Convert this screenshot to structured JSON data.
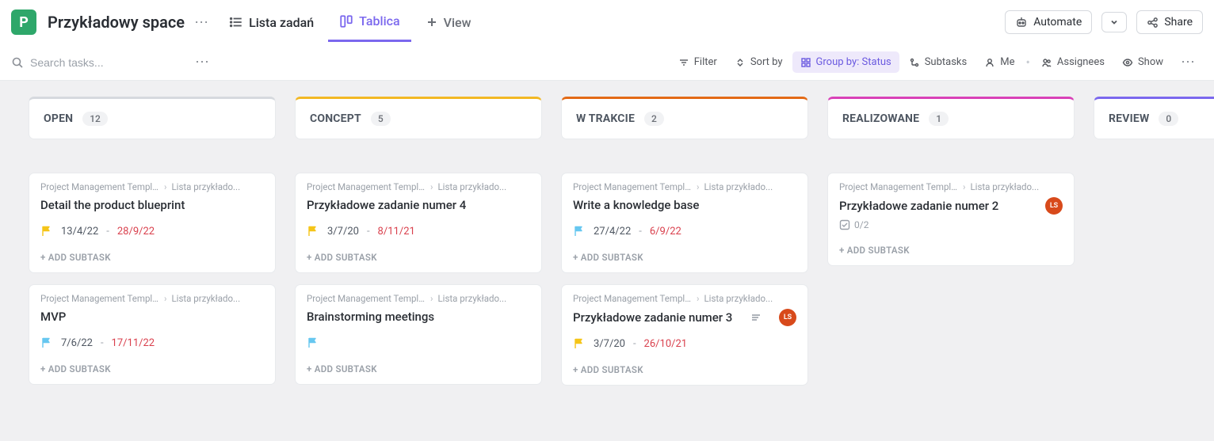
{
  "header": {
    "space_initial": "P",
    "space_title": "Przykładowy space",
    "tabs": {
      "list": "Lista zadań",
      "board": "Tablica",
      "add": "View"
    },
    "automate": "Automate",
    "share": "Share"
  },
  "toolbar": {
    "search_placeholder": "Search tasks...",
    "filter": "Filter",
    "sort": "Sort by",
    "group": "Group by: Status",
    "subtasks": "Subtasks",
    "me": "Me",
    "assignees": "Assignees",
    "show": "Show"
  },
  "columns": [
    {
      "title": "OPEN",
      "count": "12",
      "color": "#d6d9de",
      "cards": [
        {
          "bc1": "Project Management Template ...",
          "bc2": "Lista przykłado...",
          "title": "Detail the product blueprint",
          "flag": "#f5c518",
          "start": "13/4/22",
          "due": "28/9/22",
          "add_label": "ADD SUBTASK"
        },
        {
          "bc1": "Project Management Template ...",
          "bc2": "Lista przykłado...",
          "title": "MVP",
          "flag": "#67c7f0",
          "start": "7/6/22",
          "due": "17/11/22",
          "add_label": "ADD SUBTASK"
        }
      ]
    },
    {
      "title": "CONCEPT",
      "count": "5",
      "color": "#f2b824",
      "cards": [
        {
          "bc1": "Project Management Template ...",
          "bc2": "Lista przykłado...",
          "title": "Przykładowe zadanie numer 4",
          "flag": "#f5c518",
          "start": "3/7/20",
          "due": "8/11/21",
          "add_label": "ADD SUBTASK"
        },
        {
          "bc1": "Project Management Template ...",
          "bc2": "Lista przykłado...",
          "title": "Brainstorming meetings",
          "flag": "#67c7f0",
          "flag_only": true,
          "add_label": "ADD SUBTASK"
        }
      ]
    },
    {
      "title": "W TRAKCIE",
      "count": "2",
      "color": "#e36a16",
      "cards": [
        {
          "bc1": "Project Management Template ...",
          "bc2": "Lista przykłado...",
          "title": "Write a knowledge base",
          "flag": "#67c7f0",
          "start": "27/4/22",
          "due": "6/9/22",
          "add_label": "ADD SUBTASK"
        },
        {
          "bc1": "Project Management Template ...",
          "bc2": "Lista przykłado...",
          "title": "Przykładowe zadanie numer 3",
          "flag": "#f5c518",
          "start": "3/7/20",
          "due": "26/10/21",
          "bars": true,
          "avatar": "LS",
          "add_label": "ADD SUBTASK"
        }
      ]
    },
    {
      "title": "REALIZOWANE",
      "count": "1",
      "color": "#d941b8",
      "cards": [
        {
          "bc1": "Project Management Template ...",
          "bc2": "Lista przykłado...",
          "title": "Przykładowe zadanie numer 2",
          "avatar": "LS",
          "subtasks": "0/2",
          "add_label": "ADD SUBTASK"
        }
      ]
    },
    {
      "title": "REVIEW",
      "count": "0",
      "color": "#7b68ee",
      "cards": []
    }
  ]
}
